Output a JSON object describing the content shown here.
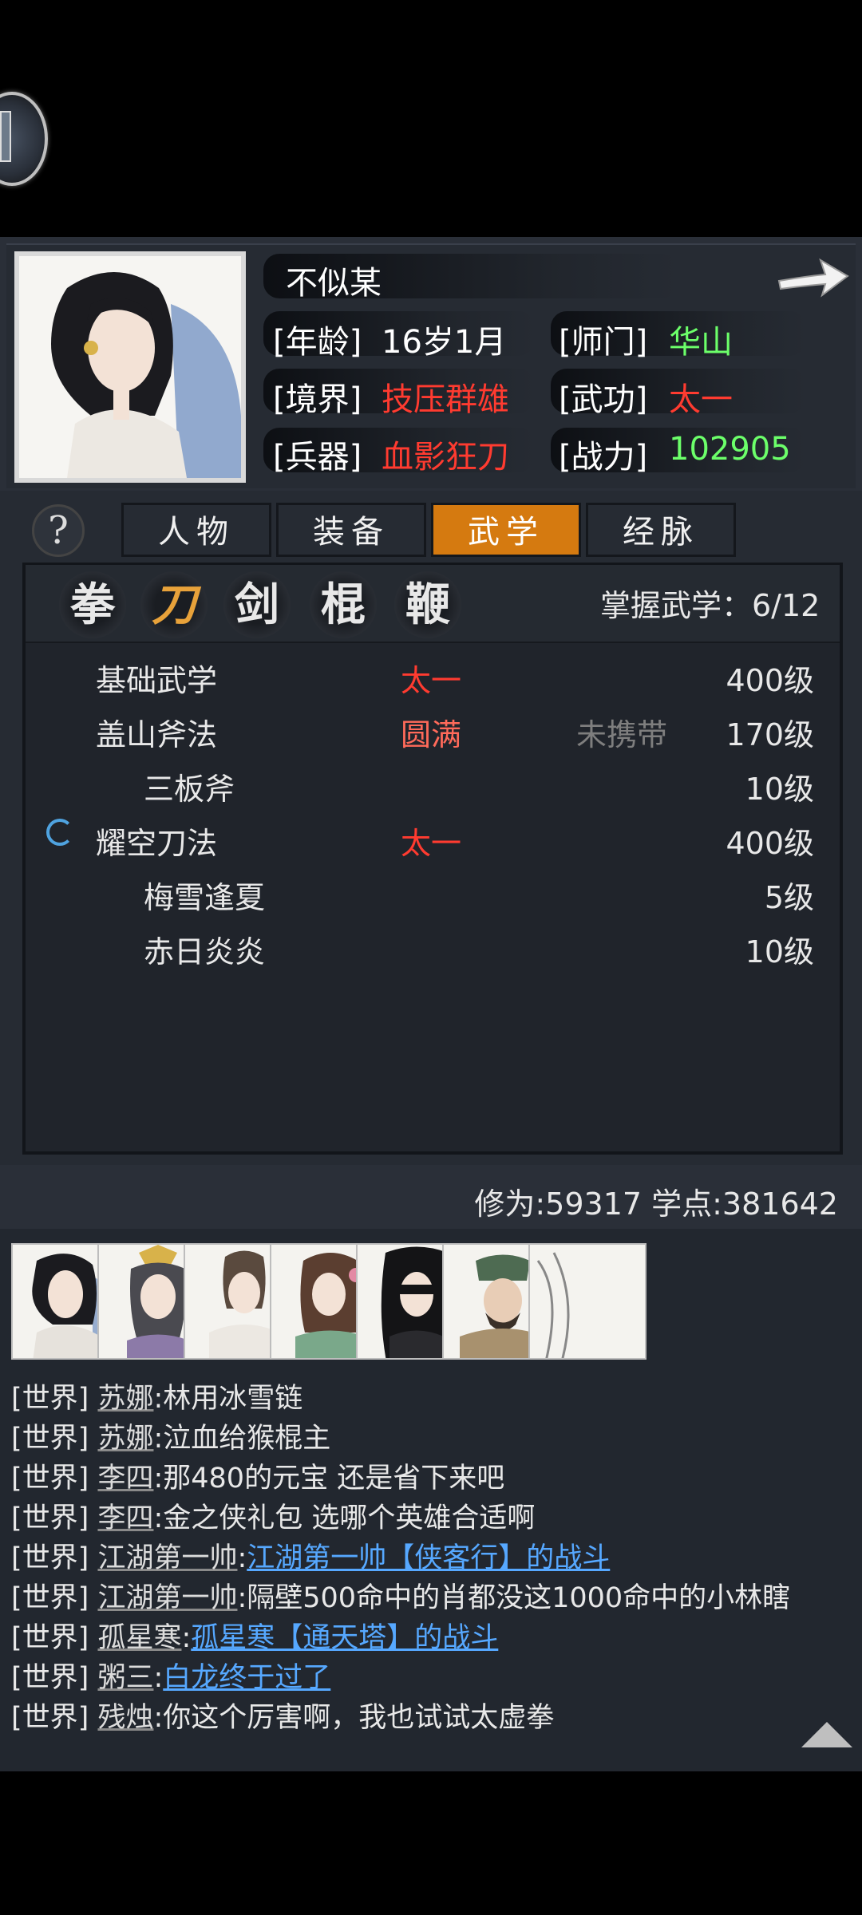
{
  "profile": {
    "name": "不似某",
    "age_label": "[年龄]",
    "age_value": "16岁1月",
    "sect_label": "[师门]",
    "sect_value": "华山",
    "realm_label": "[境界]",
    "realm_value": "技压群雄",
    "martial_label": "[武功]",
    "martial_value": "太一",
    "weapon_label": "[兵器]",
    "weapon_value": "血影狂刀",
    "power_label": "[战力]",
    "power_value": "102905"
  },
  "tabs": {
    "help": "?",
    "items": [
      "人物",
      "装备",
      "武学",
      "经脉"
    ],
    "active": "武学"
  },
  "weapon_types": [
    "拳",
    "刀",
    "剑",
    "棍",
    "鞭"
  ],
  "active_weapon_type": "刀",
  "mastery": "掌握武学：6/12",
  "skills": [
    {
      "name": "基础武学",
      "tier": "太一",
      "carry": "",
      "level": "400级"
    },
    {
      "name": "盖山斧法",
      "tier": "圆满",
      "carry": "未携带",
      "level": "170级"
    },
    {
      "name": "三板斧",
      "tier": "",
      "carry": "",
      "level": "10级"
    },
    {
      "name": "耀空刀法",
      "tier": "太一",
      "carry": "",
      "level": "400级"
    },
    {
      "name": "梅雪逢夏",
      "tier": "",
      "carry": "",
      "level": "5级"
    },
    {
      "name": "赤日炎炎",
      "tier": "",
      "carry": "",
      "level": "10级"
    }
  ],
  "stats": "修为:59317  学点:381642",
  "chat": [
    {
      "channel": "[世界]",
      "who": "苏娜",
      "text": ":林用冰雪链",
      "link": ""
    },
    {
      "channel": "[世界]",
      "who": "苏娜",
      "text": ":泣血给猴棍主",
      "link": ""
    },
    {
      "channel": "[世界]",
      "who": "李四",
      "text": ":那480的元宝 还是省下来吧",
      "link": ""
    },
    {
      "channel": "[世界]",
      "who": "李四",
      "text": ":金之侠礼包 选哪个英雄合适啊",
      "link": ""
    },
    {
      "channel": "[世界]",
      "who": "江湖第一帅",
      "text": ":",
      "link": "江湖第一帅【侠客行】的战斗"
    },
    {
      "channel": "[世界]",
      "who": "江湖第一帅",
      "text": ":隔壁500命中的肖都没这1000命中的小林瞎",
      "link": ""
    },
    {
      "channel": "[世界]",
      "who": "孤星寒",
      "text": ":",
      "link": "孤星寒【通天塔】的战斗"
    },
    {
      "channel": "[世界]",
      "who": "粥三",
      "text": ":",
      "link": "白龙终于过了"
    },
    {
      "channel": "[世界]",
      "who": "残烛",
      "text": ":你这个厉害啊，我也试试太虚拳",
      "link": ""
    }
  ]
}
